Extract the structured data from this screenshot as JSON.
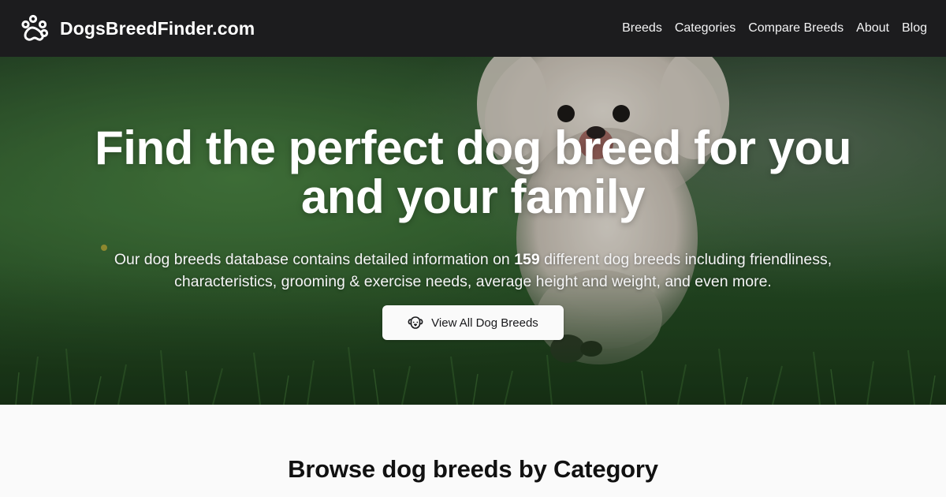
{
  "nav": {
    "brand": "DogsBreedFinder.com",
    "links": [
      "Breeds",
      "Categories",
      "Compare Breeds",
      "About",
      "Blog"
    ]
  },
  "hero": {
    "title": "Find the perfect dog breed for you and your family",
    "desc_before": "Our dog breeds database contains detailed information on ",
    "breed_count": "159",
    "desc_after": " different dog breeds including friendliness, characteristics, grooming & exercise needs, average height and weight, and even more.",
    "cta_label": "View All Dog Breeds",
    "cta_icon": "dog-face-icon"
  },
  "browse": {
    "title": "Browse dog breeds by Category"
  },
  "icons": {
    "brand": "paw-print-icon"
  },
  "colors": {
    "navbar": "#1c1c1e",
    "grass": "#2f5a2c",
    "cta_bg": "#fafafa",
    "page_bg": "#fafafa"
  }
}
